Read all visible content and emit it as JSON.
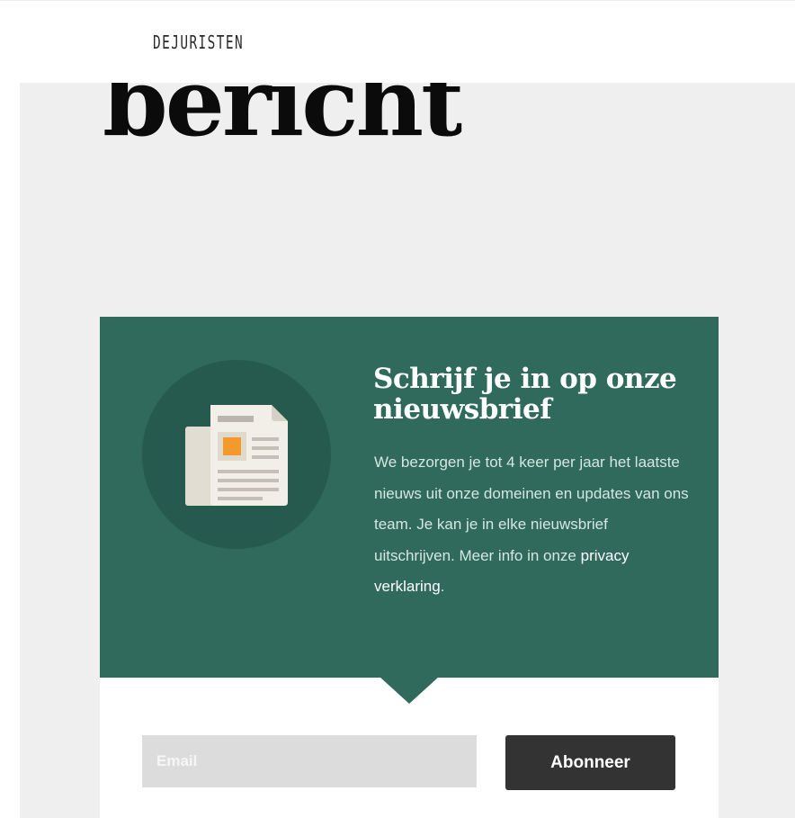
{
  "header": {
    "brand": "DEJURISTEN"
  },
  "page": {
    "headline_partial": "bericht"
  },
  "newsletter": {
    "icon": "newspaper-icon",
    "title": "Schrijf je in op onze nieuwsbrief",
    "description": "We bezorgen je tot 4 keer per jaar het laatste nieuws uit onze domeinen en updates van ons team. Je kan je in elke nieuwsbrief uitschrijven. Meer info in onze",
    "privacy_link": "privacy verklaring",
    "privacy_suffix": ".",
    "email_placeholder": "Email",
    "email_value": "",
    "subscribe_label": "Abonneer",
    "colors": {
      "card_background": "#2f6a5d",
      "icon_circle": "#275a4f",
      "accent_orange": "#f29a2e",
      "button_background": "#333333"
    }
  }
}
